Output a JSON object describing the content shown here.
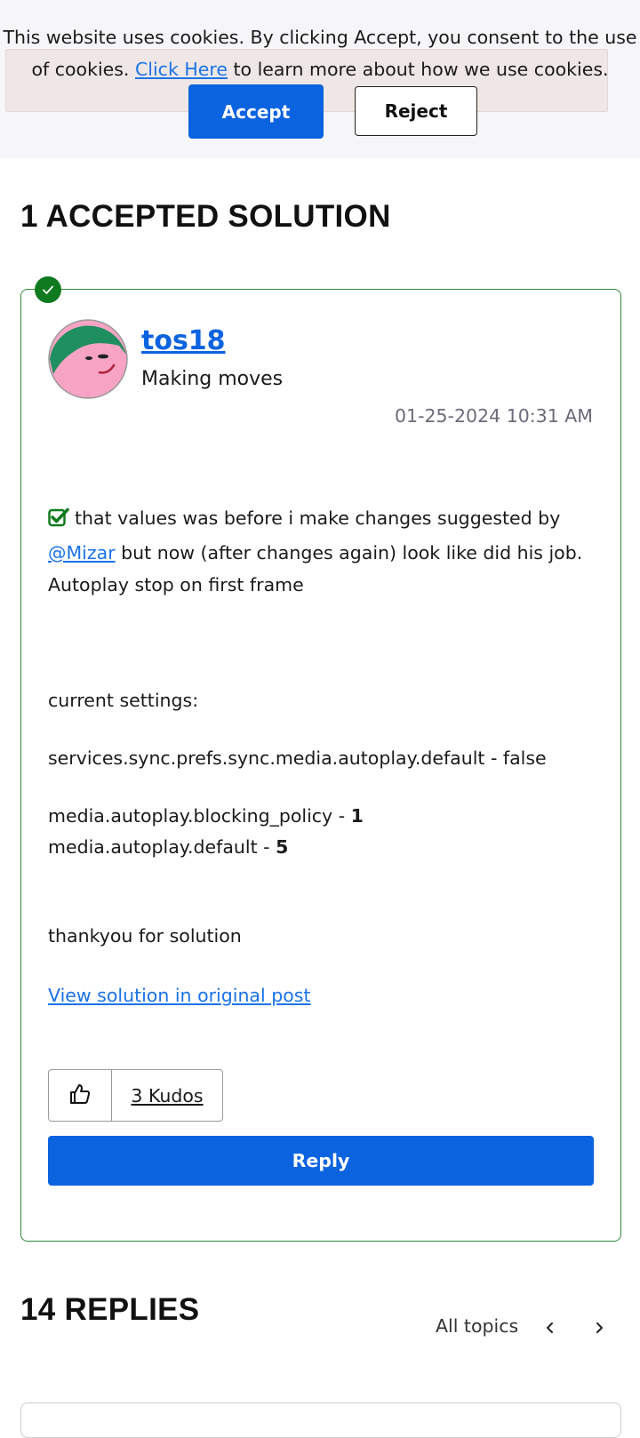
{
  "cookie_banner": {
    "text_before": "This website uses cookies. By clicking Accept, you consent to the use of cookies. ",
    "link": "Click Here",
    "text_after": " to learn more about how we use cookies.",
    "accept": "Accept",
    "reject": "Reject"
  },
  "accepted_heading": "1 ACCEPTED SOLUTION",
  "post": {
    "author": "tos18",
    "rank": "Making moves",
    "date": "01-25-2024",
    "time": "10:31 AM",
    "line1": "that values was before i make changes suggested by",
    "mention": "@Mizar",
    "line2_rest": " but now (after changes again) look like did his job.",
    "line3": "Autoplay stop on first frame",
    "settings_label": "current settings:",
    "setting1": "services.sync.prefs.sync.media.autoplay.default - false",
    "setting2_label": "media.autoplay.blocking_policy - ",
    "setting2_value": "1",
    "setting3_label": "media.autoplay.default - ",
    "setting3_value": "5",
    "thanks": "thankyou for solution",
    "view_solution": "View solution in original post",
    "kudos": "3 Kudos",
    "reply": "Reply"
  },
  "replies": {
    "heading": "14 REPLIES",
    "topics": "All topics"
  },
  "colors": {
    "accent_blue": "#0b63e0",
    "solved_green": "#0f7a1f",
    "avatar_pink": "#f7a3c4",
    "avatar_green": "#1f8f5f"
  }
}
